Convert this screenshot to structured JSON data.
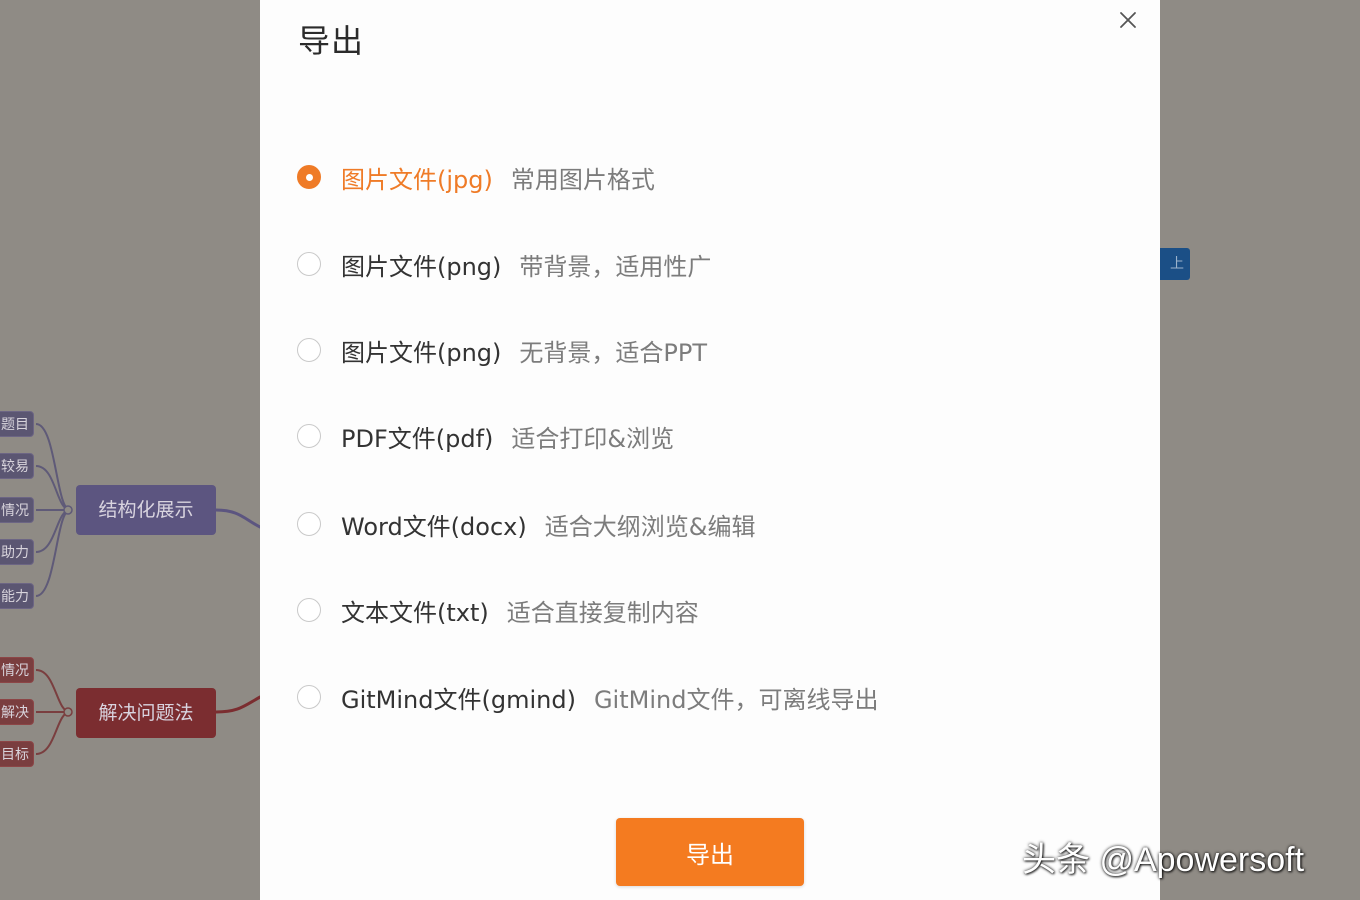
{
  "background": {
    "group1": {
      "topic": "结构化展示",
      "leaves": [
        "题目",
        "较易",
        "情况",
        "助力",
        "能力"
      ]
    },
    "group2": {
      "topic": "解决问题法",
      "leaves": [
        "情况",
        "解决",
        "目标"
      ]
    },
    "right_node": "上"
  },
  "dialog": {
    "title": "导出",
    "close_icon": "close-icon",
    "options": [
      {
        "label": "图片文件(jpg)",
        "desc": "常用图片格式",
        "selected": true
      },
      {
        "label": "图片文件(png)",
        "desc": "带背景，适用性广",
        "selected": false
      },
      {
        "label": "图片文件(png)",
        "desc": "无背景，适合PPT",
        "selected": false
      },
      {
        "label": "PDF文件(pdf)",
        "desc": "适合打印&浏览",
        "selected": false
      },
      {
        "label": "Word文件(docx)",
        "desc": "适合大纲浏览&编辑",
        "selected": false
      },
      {
        "label": "文本文件(txt)",
        "desc": "适合直接复制内容",
        "selected": false
      },
      {
        "label": "GitMind文件(gmind)",
        "desc": "GitMind文件，可离线导出",
        "selected": false
      }
    ],
    "export_button": "导出"
  },
  "watermark": "头条 @Apowersoft",
  "colors": {
    "accent": "#f47b20",
    "overlay": "#8f8b85",
    "topic_purple": "#5c5580",
    "topic_red": "#7b2d30"
  }
}
